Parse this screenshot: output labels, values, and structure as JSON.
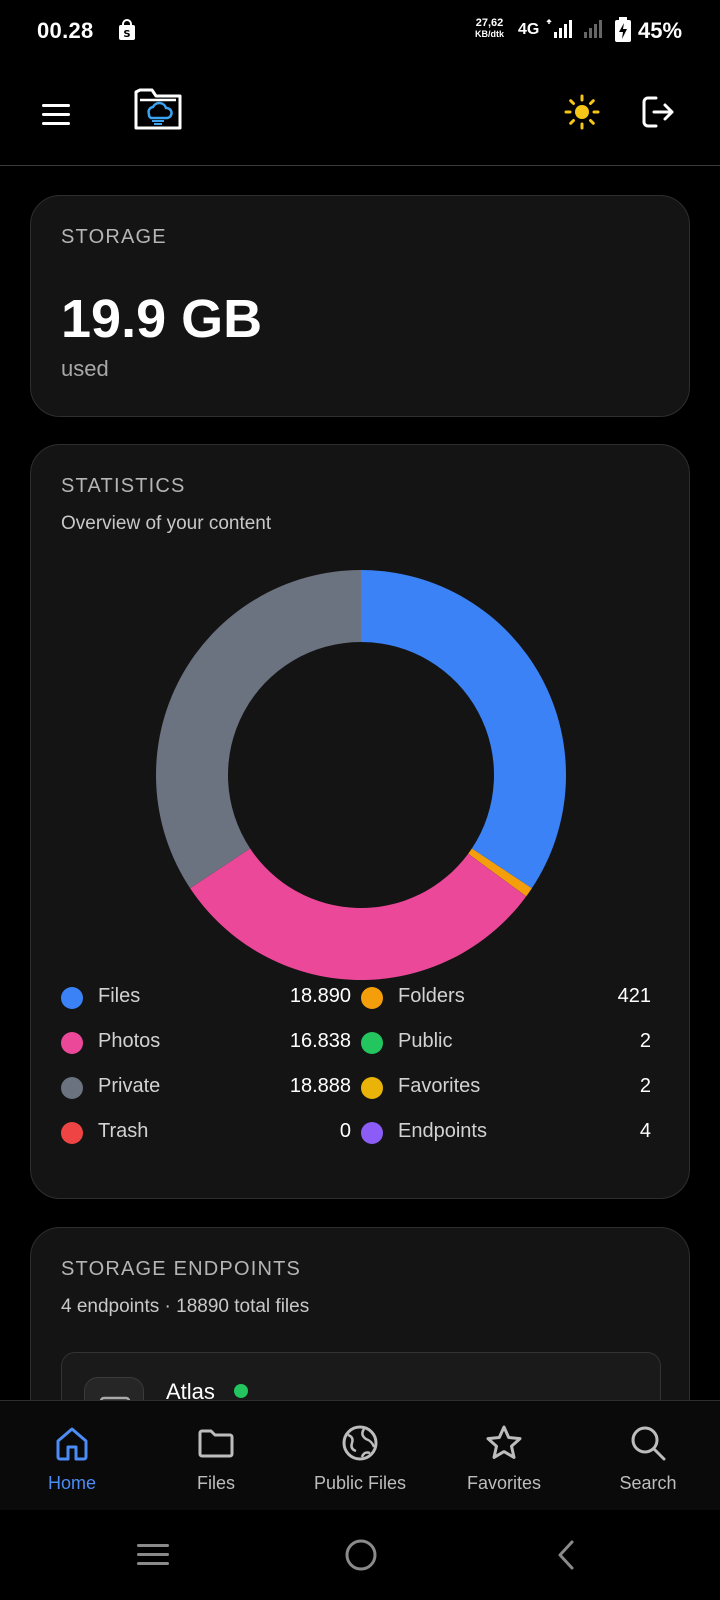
{
  "status_bar": {
    "time": "00.28",
    "speed_value": "27,62",
    "speed_unit": "KB/dtk",
    "network": "4G",
    "battery": "45%"
  },
  "app_bar": {
    "menu_icon": "hamburger-menu-icon",
    "logo_icon": "cloud-folder-logo",
    "theme_icon": "sun-icon",
    "logout_icon": "logout-icon",
    "theme_color": "#f5c518"
  },
  "storage": {
    "title": "STORAGE",
    "value": "19.9 GB",
    "unit": "used"
  },
  "statistics": {
    "title": "STATISTICS",
    "subtitle": "Overview of your content",
    "legend": [
      {
        "label": "Files",
        "count": "18.890",
        "color": "#3b82f6"
      },
      {
        "label": "Folders",
        "count": "421",
        "color": "#f59e0b"
      },
      {
        "label": "Photos",
        "count": "16.838",
        "color": "#ec4899"
      },
      {
        "label": "Public",
        "count": "2",
        "color": "#22c55e"
      },
      {
        "label": "Private",
        "count": "18.888",
        "color": "#6b7280"
      },
      {
        "label": "Favorites",
        "count": "2",
        "color": "#eab308"
      },
      {
        "label": "Trash",
        "count": "0",
        "color": "#ef4444"
      },
      {
        "label": "Endpoints",
        "count": "4",
        "color": "#8b5cf6"
      }
    ]
  },
  "chart_data": {
    "type": "pie",
    "style": "donut",
    "categories": [
      "Files",
      "Folders",
      "Photos",
      "Public",
      "Private",
      "Favorites",
      "Trash",
      "Endpoints"
    ],
    "values": [
      18890,
      421,
      16838,
      2,
      18888,
      2,
      0,
      4
    ],
    "colors": [
      "#3b82f6",
      "#f59e0b",
      "#ec4899",
      "#22c55e",
      "#6b7280",
      "#eab308",
      "#ef4444",
      "#8b5cf6"
    ],
    "legend": "bottom",
    "title": ""
  },
  "endpoints": {
    "title": "STORAGE ENDPOINTS",
    "summary": "4 endpoints · 18890 total files",
    "items": [
      {
        "name": "Atlas",
        "status_color": "#22c55e",
        "icon": "server-icon"
      }
    ]
  },
  "bottom_nav": {
    "active_color": "#4c8cf5",
    "items": [
      {
        "label": "Home",
        "icon": "home-icon"
      },
      {
        "label": "Files",
        "icon": "folder-icon"
      },
      {
        "label": "Public Files",
        "icon": "globe-icon"
      },
      {
        "label": "Favorites",
        "icon": "star-icon"
      },
      {
        "label": "Search",
        "icon": "search-icon"
      }
    ]
  },
  "system_nav": {
    "items": [
      "recent-apps-icon",
      "home-circle-icon",
      "back-icon"
    ]
  }
}
